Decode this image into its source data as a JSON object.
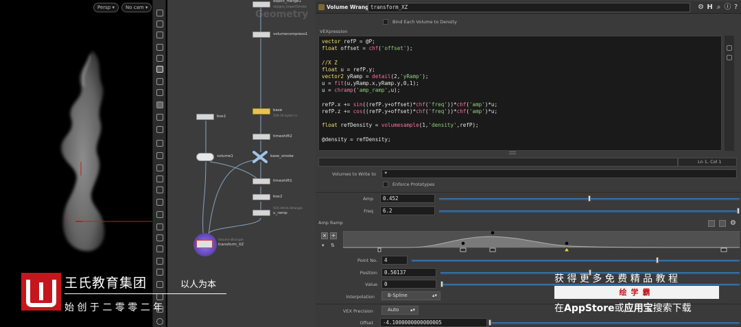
{
  "viewport": {
    "persp_label": "Persp ▾",
    "cam_label": "No cam ▾"
  },
  "network": {
    "watermark": "Geometry",
    "nodes": {
      "top1_name": "object_merge1",
      "top1_sub": "obj/geo_importSmoke",
      "volumecompress": "volumecompress1",
      "box1": "box1",
      "base": "base",
      "base_sub": "509.1K bytes in",
      "timeshift2": "timeshift2",
      "volume1": "volume1",
      "base_smoke": "base_smoke",
      "timeshift1": "timeshift1",
      "box2": "box2",
      "u_ramp": "u_ramp",
      "u_ramp_sub": "VEX Attrib Wrangle",
      "transform": "transform_XZ",
      "transform_sub": "Volume Wrangle"
    }
  },
  "params": {
    "node_type": "Volume Wrangle",
    "node_name": "transform_XZ",
    "bind_each": "Bind Each Volume to Density",
    "vex_label": "VEXpression",
    "cursor_pos": "Ln 1, Col 1",
    "volumes_label": "Volumes to Write to",
    "volumes_value": "*",
    "enforce_label": "Enforce Prototypes",
    "amp_label": "Amp",
    "amp_value": "0.452",
    "amp_fraction": 0.5,
    "freq_label": "Freq",
    "freq_value": "6.2",
    "freq_fraction": 1.0,
    "ramp_label": "Amp Ramp",
    "point_no_label": "Point No.",
    "point_no_value": "4",
    "point_no_fraction": 0.75,
    "position_label": "Position",
    "position_value": "0.50137",
    "position_fraction": 0.5,
    "value_label": "Value",
    "value_value": "0",
    "value_fraction": 0.0,
    "interp_label": "Interpolation",
    "interp_value": "B-Spline",
    "vexprec_label": "VEX Precision",
    "vexprec_value": "Auto",
    "offset_label": "Offset",
    "offset_value": "-4.1000000000000005"
  },
  "overlay": {
    "company": "王氏教育集团",
    "slogan": "以人为本",
    "founded": "始 创 于 二 零 零 二 年",
    "promo_line1": "获 得 更 多 免 费 精 品 教 程",
    "promo_brand": "绘学霸",
    "promo_line2_a": "在",
    "promo_line2_b": "AppStore",
    "promo_line2_c": "或",
    "promo_line2_d": "应用宝",
    "promo_line2_e": "搜索下载"
  },
  "colors": {
    "accent_red": "#c4161c",
    "slider_blue": "#2a5d8f",
    "node_yellow": "#e6c34e"
  }
}
